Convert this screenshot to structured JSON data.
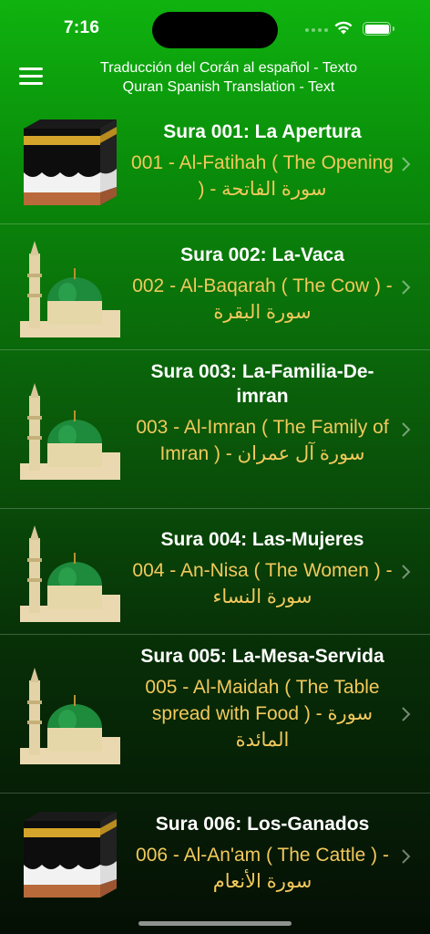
{
  "status": {
    "time": "7:16"
  },
  "nav": {
    "title_line1": "Traducción del Corán al español - Texto",
    "title_line2": "Quran Spanish Translation - Text"
  },
  "surahs": [
    {
      "title": "Sura 001: La Apertura",
      "subtitle": "001 - Al-Fatihah ( The Opening ) - سورة الفاتحة",
      "image": "kaaba"
    },
    {
      "title": "Sura 002: La-Vaca",
      "subtitle": "002 - Al-Baqarah ( The Cow ) - سورة البقرة",
      "image": "medina"
    },
    {
      "title": "Sura 003: La-Familia-De-imran",
      "subtitle": "003 - Al-Imran ( The Family of Imran ) - سورة آل عمران",
      "image": "medina"
    },
    {
      "title": "Sura 004: Las-Mujeres",
      "subtitle": "004 - An-Nisa ( The Women ) - سورة النساء",
      "image": "medina"
    },
    {
      "title": "Sura 005: La-Mesa-Servida",
      "subtitle": "005 - Al-Maidah ( The Table spread with Food ) - سورة المائدة",
      "image": "medina"
    },
    {
      "title": "Sura 006: Los-Ganados",
      "subtitle": "006 - Al-An'am ( The Cattle ) - سورة الأنعام",
      "image": "kaaba"
    }
  ]
}
